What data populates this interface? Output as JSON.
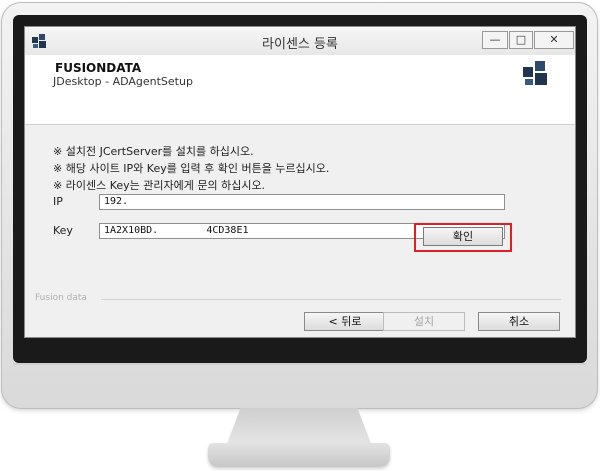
{
  "window": {
    "title": "라이센스 등록",
    "minimize_label": "—",
    "maximize_label": "□",
    "close_label": "✕"
  },
  "header": {
    "company": "FUSIONDATA",
    "subtitle": "JDesktop - ADAgentSetup"
  },
  "notices": [
    "※ 설치전 JCertServer를 설치를 하십시오.",
    "※ 해당 사이트 IP와 Key를 입력 후 확인 버튼을 누르십시오.",
    "※ 라이센스 Key는 관리자에게 문의 하십시오."
  ],
  "form": {
    "ip_label": "IP",
    "ip_value": "192.",
    "key_label": "Key",
    "key_value": "1A2X10BD.        4CD38E1",
    "confirm_label": "확인"
  },
  "footer": {
    "label": "Fusion data",
    "back_label": "< 뒤로",
    "install_label": "설치",
    "cancel_label": "취소"
  },
  "colors": {
    "highlight": "#e02020",
    "brand_dark": "#1f3550"
  }
}
